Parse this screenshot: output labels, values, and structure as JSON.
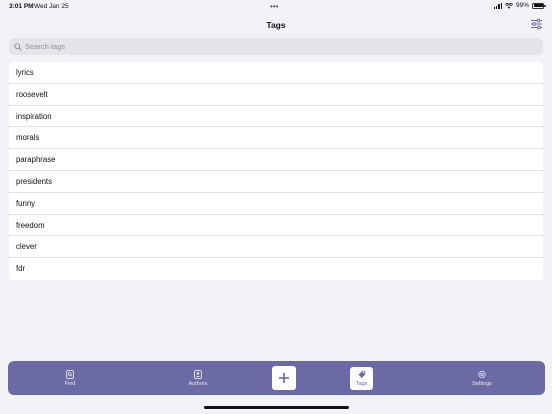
{
  "status": {
    "time": "3:01 PM",
    "date": "Wed Jan 25",
    "battery": "99%"
  },
  "nav": {
    "title": "Tags",
    "filter_icon": "sliders-icon"
  },
  "search": {
    "placeholder": "Search tags",
    "value": ""
  },
  "tags": [
    "lyrics",
    "roosevelt",
    "inspiration",
    "morals",
    "paraphrase",
    "presidents",
    "funny",
    "freedom",
    "clever",
    "fdr"
  ],
  "tabbar": {
    "find": "Find",
    "authors": "Authors",
    "tags": "Tags",
    "settings": "Settings",
    "add_icon": "plus-icon"
  },
  "colors": {
    "accent": "#6b6aa4",
    "background": "#f2f2f7"
  }
}
